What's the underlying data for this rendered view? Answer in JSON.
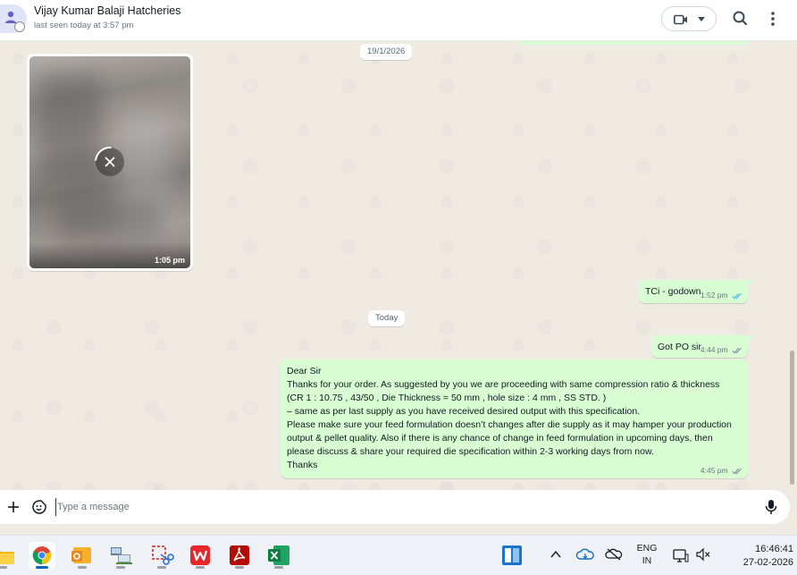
{
  "header": {
    "contact_name": "Vijay Kumar Balaji Hatcheries",
    "last_seen": "last seen today at 3:57 pm"
  },
  "chat": {
    "date_chip_1": "19/1/2026",
    "date_chip_2": "Today",
    "image_message": {
      "time": "1:05 pm"
    },
    "messages": [
      {
        "text": "TCi - godown",
        "time": "1:52 pm"
      },
      {
        "text": "Got PO sir",
        "time": "4:44 pm"
      },
      {
        "lines": [
          "Dear Sir",
          "Thanks for your order. As suggested by you we are proceeding with same compression ratio & thickness",
          "(CR 1 : 10.75 , 43/50 , Die Thickness = 50 mm , hole size : 4 mm , SS STD.  )",
          "– same as per last supply as you have received desired output with this specification.",
          "Please make sure your feed formulation doesn’t changes after die supply as it may hamper your production",
          "output & pellet quality. Also if there is any chance of change in feed formulation in upcoming days, then",
          "please discuss & share your required die specification within 2-3 working days from now.",
          "Thanks"
        ],
        "time": "4:45 pm"
      }
    ]
  },
  "compose": {
    "placeholder": "Type a message"
  },
  "taskbar": {
    "language_top": "ENG",
    "language_bottom": "IN",
    "time": "16:46:41",
    "date": "27-02-2026"
  },
  "colors": {
    "outgoing_bubble": "#d9fdd3",
    "chat_background": "#efeae2",
    "read_ticks": "#53bdeb"
  }
}
